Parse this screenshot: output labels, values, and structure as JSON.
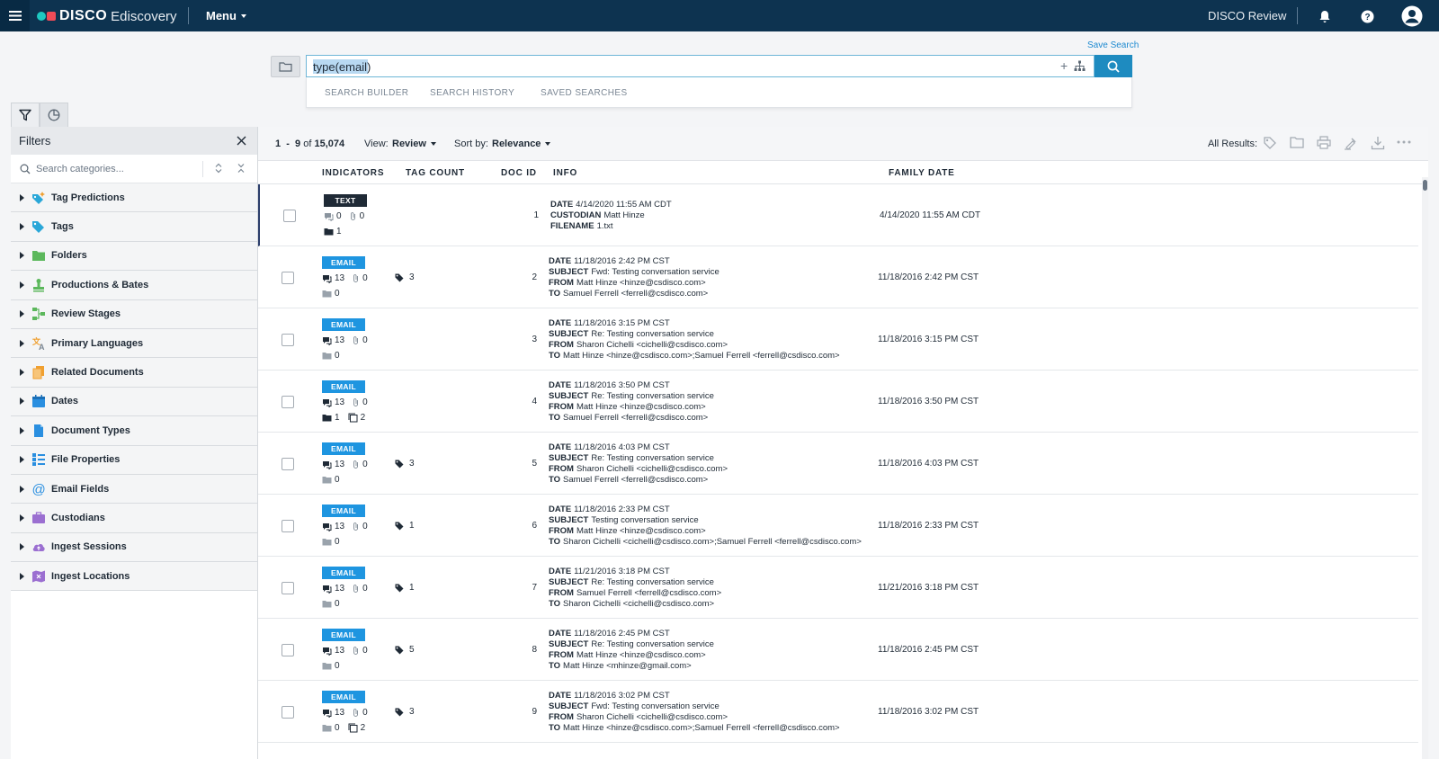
{
  "header": {
    "logo_mark": "DISCO",
    "logo_suffix": "Ediscovery",
    "menu_label": "Menu",
    "product_name": "DISCO Review"
  },
  "search": {
    "save_label": "Save Search",
    "query": "type(email)",
    "plus_symbol": "+",
    "tabs": [
      "SEARCH BUILDER",
      "SEARCH HISTORY",
      "SAVED SEARCHES"
    ]
  },
  "filters": {
    "title": "Filters",
    "search_placeholder": "Search categories...",
    "categories": [
      {
        "label": "Tag Predictions",
        "icon": "tag-prediction-icon",
        "color": "#2aa7d8"
      },
      {
        "label": "Tags",
        "icon": "tag-icon",
        "color": "#2aa7d8"
      },
      {
        "label": "Folders",
        "icon": "folder-icon",
        "color": "#5cb85c"
      },
      {
        "label": "Productions & Bates",
        "icon": "stamp-icon",
        "color": "#5cb85c"
      },
      {
        "label": "Review Stages",
        "icon": "review-stages-icon",
        "color": "#5cb85c"
      },
      {
        "label": "Primary Languages",
        "icon": "language-icon",
        "color": "#f0a030"
      },
      {
        "label": "Related Documents",
        "icon": "related-documents-icon",
        "color": "#f0a030"
      },
      {
        "label": "Dates",
        "icon": "calendar-icon",
        "color": "#2a8fe0"
      },
      {
        "label": "Document Types",
        "icon": "document-icon",
        "color": "#2a8fe0"
      },
      {
        "label": "File Properties",
        "icon": "file-properties-icon",
        "color": "#2a8fe0"
      },
      {
        "label": "Email Fields",
        "icon": "at-icon",
        "color": "#2a8fe0"
      },
      {
        "label": "Custodians",
        "icon": "briefcase-icon",
        "color": "#9b6fd1"
      },
      {
        "label": "Ingest Sessions",
        "icon": "cloud-upload-icon",
        "color": "#9b6fd1"
      },
      {
        "label": "Ingest Locations",
        "icon": "map-icon",
        "color": "#9b6fd1"
      }
    ]
  },
  "results": {
    "range_start": "1",
    "range_sep": "-",
    "range_end": "9",
    "of_label": "of",
    "total": "15,074",
    "view_label": "View:",
    "view_value": "Review",
    "sort_label": "Sort by:",
    "sort_value": "Relevance",
    "all_results_label": "All Results:",
    "columns": [
      "INDICATORS",
      "TAG COUNT",
      "DOC ID",
      "INFO",
      "FAMILY DATE"
    ],
    "rows": [
      {
        "type": "TEXT",
        "comments": "0",
        "attachments": "0",
        "folders": "1",
        "family": "",
        "tags": "",
        "doc_id": "1",
        "info": [
          [
            "DATE",
            "4/14/2020 11:55 AM CDT"
          ],
          [
            "CUSTODIAN",
            "Matt Hinze"
          ],
          [
            "FILENAME",
            "1.txt"
          ]
        ],
        "family_date": "4/14/2020 11:55 AM CDT"
      },
      {
        "type": "EMAIL",
        "comments": "13",
        "attachments": "0",
        "folders": "0",
        "family": "",
        "tags": "3",
        "doc_id": "2",
        "info": [
          [
            "DATE",
            "11/18/2016 2:42 PM CST"
          ],
          [
            "SUBJECT",
            "Fwd: Testing conversation service"
          ],
          [
            "FROM",
            "Matt Hinze <hinze@csdisco.com>"
          ],
          [
            "TO",
            "Samuel Ferrell <ferrell@csdisco.com>"
          ]
        ],
        "family_date": "11/18/2016 2:42 PM CST"
      },
      {
        "type": "EMAIL",
        "comments": "13",
        "attachments": "0",
        "folders": "0",
        "family": "",
        "tags": "",
        "doc_id": "3",
        "info": [
          [
            "DATE",
            "11/18/2016 3:15 PM CST"
          ],
          [
            "SUBJECT",
            "Re: Testing conversation service"
          ],
          [
            "FROM",
            "Sharon Cichelli <cichelli@csdisco.com>"
          ],
          [
            "TO",
            "Matt Hinze <hinze@csdisco.com>;Samuel Ferrell <ferrell@csdisco.com>"
          ]
        ],
        "family_date": "11/18/2016 3:15 PM CST"
      },
      {
        "type": "EMAIL",
        "comments": "13",
        "attachments": "0",
        "folders": "1",
        "family": "2",
        "tags": "",
        "doc_id": "4",
        "info": [
          [
            "DATE",
            "11/18/2016 3:50 PM CST"
          ],
          [
            "SUBJECT",
            "Re: Testing conversation service"
          ],
          [
            "FROM",
            "Matt Hinze <hinze@csdisco.com>"
          ],
          [
            "TO",
            "Samuel Ferrell <ferrell@csdisco.com>"
          ]
        ],
        "family_date": "11/18/2016 3:50 PM CST"
      },
      {
        "type": "EMAIL",
        "comments": "13",
        "attachments": "0",
        "folders": "0",
        "family": "",
        "tags": "3",
        "doc_id": "5",
        "info": [
          [
            "DATE",
            "11/18/2016 4:03 PM CST"
          ],
          [
            "SUBJECT",
            "Re: Testing conversation service"
          ],
          [
            "FROM",
            "Sharon Cichelli <cichelli@csdisco.com>"
          ],
          [
            "TO",
            "Samuel Ferrell <ferrell@csdisco.com>"
          ]
        ],
        "family_date": "11/18/2016 4:03 PM CST"
      },
      {
        "type": "EMAIL",
        "comments": "13",
        "attachments": "0",
        "folders": "0",
        "family": "",
        "tags": "1",
        "doc_id": "6",
        "info": [
          [
            "DATE",
            "11/18/2016 2:33 PM CST"
          ],
          [
            "SUBJECT",
            "Testing conversation service"
          ],
          [
            "FROM",
            "Matt Hinze <hinze@csdisco.com>"
          ],
          [
            "TO",
            "Sharon Cichelli <cichelli@csdisco.com>;Samuel Ferrell <ferrell@csdisco.com>"
          ]
        ],
        "family_date": "11/18/2016 2:33 PM CST"
      },
      {
        "type": "EMAIL",
        "comments": "13",
        "attachments": "0",
        "folders": "0",
        "family": "",
        "tags": "1",
        "doc_id": "7",
        "info": [
          [
            "DATE",
            "11/21/2016 3:18 PM CST"
          ],
          [
            "SUBJECT",
            "Re: Testing conversation service"
          ],
          [
            "FROM",
            "Samuel Ferrell <ferrell@csdisco.com>"
          ],
          [
            "TO",
            "Sharon Cichelli <cichelli@csdisco.com>"
          ]
        ],
        "family_date": "11/21/2016 3:18 PM CST"
      },
      {
        "type": "EMAIL",
        "comments": "13",
        "attachments": "0",
        "folders": "0",
        "family": "",
        "tags": "5",
        "doc_id": "8",
        "info": [
          [
            "DATE",
            "11/18/2016 2:45 PM CST"
          ],
          [
            "SUBJECT",
            "Re: Testing conversation service"
          ],
          [
            "FROM",
            "Matt Hinze <hinze@csdisco.com>"
          ],
          [
            "TO",
            "Matt Hinze <mhinze@gmail.com>"
          ]
        ],
        "family_date": "11/18/2016 2:45 PM CST"
      },
      {
        "type": "EMAIL",
        "comments": "13",
        "attachments": "0",
        "folders": "0",
        "family": "2",
        "tags": "3",
        "doc_id": "9",
        "info": [
          [
            "DATE",
            "11/18/2016 3:02 PM CST"
          ],
          [
            "SUBJECT",
            "Fwd: Testing conversation service"
          ],
          [
            "FROM",
            "Sharon Cichelli <cichelli@csdisco.com>"
          ],
          [
            "TO",
            "Matt Hinze <hinze@csdisco.com>;Samuel Ferrell <ferrell@csdisco.com>"
          ]
        ],
        "family_date": "11/18/2016 3:02 PM CST"
      }
    ]
  }
}
